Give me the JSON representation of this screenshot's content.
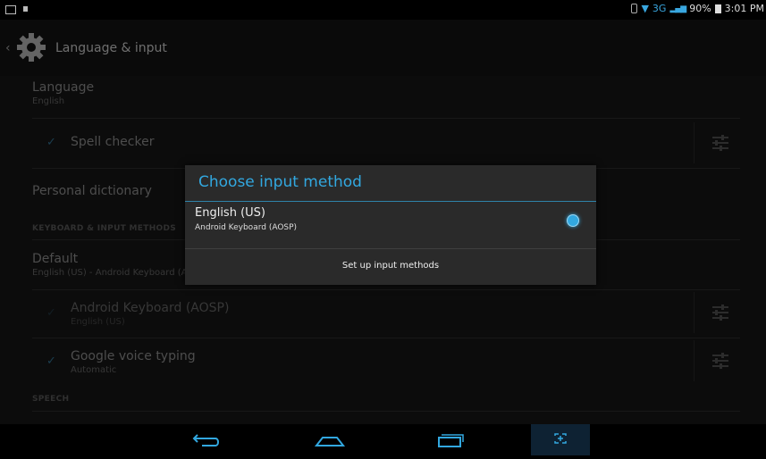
{
  "status_bar": {
    "network_type": "3G",
    "battery_percent": "90%",
    "time": "3:01 PM"
  },
  "action_bar": {
    "title": "Language & input"
  },
  "settings": {
    "language": {
      "title": "Language",
      "value": "English"
    },
    "spell_checker": {
      "title": "Spell checker",
      "checked": true
    },
    "personal_dictionary": {
      "title": "Personal dictionary"
    },
    "keyboard_category": "KEYBOARD & INPUT METHODS",
    "default": {
      "title": "Default",
      "value": "English (US) - Android Keyboard (AOSP)"
    },
    "android_keyboard": {
      "title": "Android Keyboard (AOSP)",
      "value": "English (US)",
      "checked": true,
      "disabled": true
    },
    "google_voice": {
      "title": "Google voice typing",
      "value": "Automatic",
      "checked": true
    },
    "speech_category": "SPEECH"
  },
  "dialog": {
    "title": "Choose input method",
    "option": {
      "title": "English (US)",
      "subtitle": "Android Keyboard (AOSP)",
      "selected": true
    },
    "button": "Set up input methods"
  },
  "nav_bar": {
    "icons": [
      "back-icon",
      "home-icon",
      "recent-apps-icon",
      "screenshot-icon"
    ]
  },
  "colors": {
    "accent": "#32a8e0"
  }
}
